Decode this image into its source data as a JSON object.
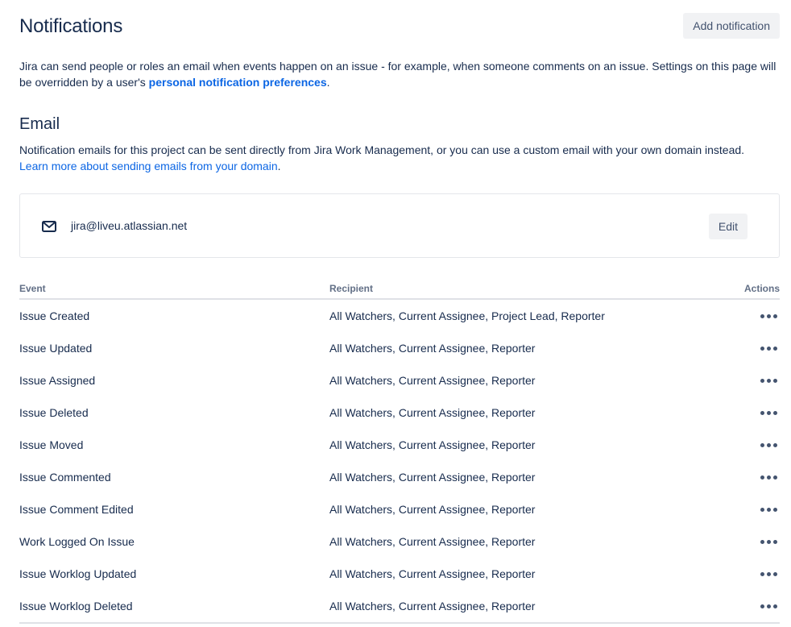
{
  "header": {
    "title": "Notifications",
    "add_button": "Add notification"
  },
  "intro": {
    "text": "Jira can send people or roles an email when events happen on an issue - for example, when someone comments on an issue. Settings on this page will be overridden by a user's ",
    "link": "personal notification preferences",
    "suffix": "."
  },
  "email_section": {
    "title": "Email",
    "description": "Notification emails for this project can be sent directly from Jira Work Management, or you can use a custom email with your own domain instead.",
    "link": "Learn more about sending emails from your domain",
    "link_suffix": ".",
    "address": "jira@liveu.atlassian.net",
    "edit_button": "Edit",
    "icon": "mail-icon"
  },
  "table": {
    "columns": {
      "event": "Event",
      "recipient": "Recipient",
      "actions": "Actions"
    },
    "rows": [
      {
        "event": "Issue Created",
        "recipient": "All Watchers, Current Assignee, Project Lead, Reporter"
      },
      {
        "event": "Issue Updated",
        "recipient": "All Watchers, Current Assignee, Reporter"
      },
      {
        "event": "Issue Assigned",
        "recipient": "All Watchers, Current Assignee, Reporter"
      },
      {
        "event": "Issue Deleted",
        "recipient": "All Watchers, Current Assignee, Reporter"
      },
      {
        "event": "Issue Moved",
        "recipient": "All Watchers, Current Assignee, Reporter"
      },
      {
        "event": "Issue Commented",
        "recipient": "All Watchers, Current Assignee, Reporter"
      },
      {
        "event": "Issue Comment Edited",
        "recipient": "All Watchers, Current Assignee, Reporter"
      },
      {
        "event": "Work Logged On Issue",
        "recipient": "All Watchers, Current Assignee, Reporter"
      },
      {
        "event": "Issue Worklog Updated",
        "recipient": "All Watchers, Current Assignee, Reporter"
      },
      {
        "event": "Issue Worklog Deleted",
        "recipient": "All Watchers, Current Assignee, Reporter"
      }
    ],
    "row_action_icon": "more-icon"
  },
  "colors": {
    "text": "#172b4d",
    "link": "#0c66e4",
    "button_bg": "#f1f2f4",
    "border": "#dfe1e6"
  }
}
